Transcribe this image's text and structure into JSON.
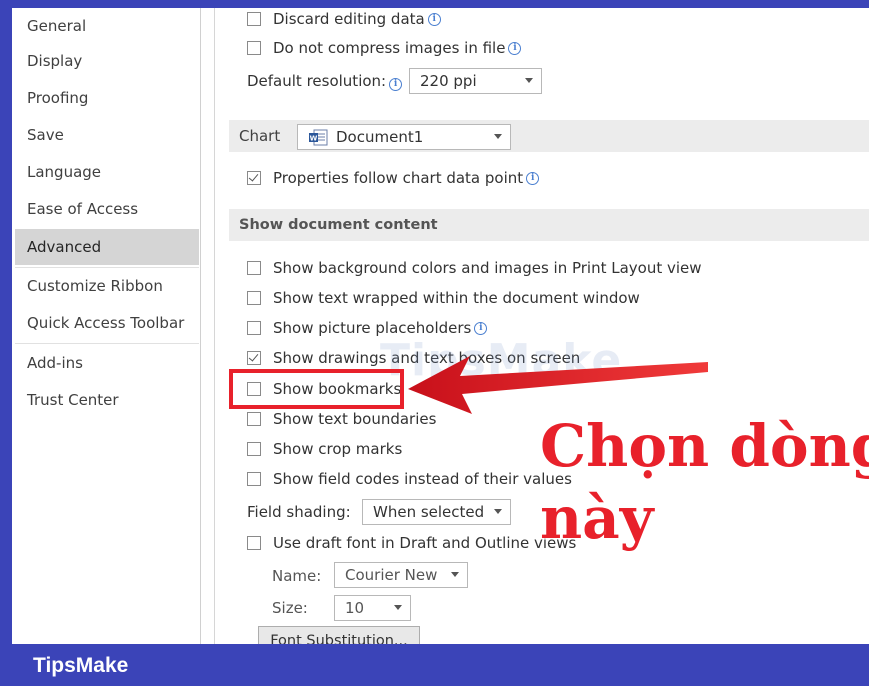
{
  "sidebar": {
    "items": [
      {
        "label": "General"
      },
      {
        "label": "Display"
      },
      {
        "label": "Proofing"
      },
      {
        "label": "Save"
      },
      {
        "label": "Language"
      },
      {
        "label": "Ease of Access"
      },
      {
        "label": "Advanced"
      },
      {
        "label": "Customize Ribbon"
      },
      {
        "label": "Quick Access Toolbar"
      },
      {
        "label": "Add-ins"
      },
      {
        "label": "Trust Center"
      }
    ],
    "active": "Advanced"
  },
  "image_size": {
    "discard_editing_data": "Discard editing data",
    "do_not_compress": "Do not compress images in file",
    "default_resolution_label": "Default resolution:",
    "default_resolution_value": "220 ppi"
  },
  "chart": {
    "section_label": "Chart",
    "document_value": "Document1",
    "properties_follow": "Properties follow chart data point"
  },
  "show_document_content": {
    "section_label": "Show document content",
    "options": [
      {
        "label": "Show background colors and images in Print Layout view",
        "checked": false
      },
      {
        "label": "Show text wrapped within the document window",
        "checked": false
      },
      {
        "label": "Show picture placeholders",
        "checked": false
      },
      {
        "label": "Show drawings and text boxes on screen",
        "checked": true
      },
      {
        "label": "Show bookmarks",
        "checked": false
      },
      {
        "label": "Show text boundaries",
        "checked": false
      },
      {
        "label": "Show crop marks",
        "checked": false
      },
      {
        "label": "Show field codes instead of their values",
        "checked": false
      }
    ],
    "field_shading_label": "Field shading:",
    "field_shading_value": "When selected",
    "draft_font": "Use draft font in Draft and Outline views",
    "name_label": "Name:",
    "name_value": "Courier New",
    "size_label": "Size:",
    "size_value": "10",
    "font_substitution": "Font Substitution..."
  },
  "annotation": {
    "line1": "Chọn dòng",
    "line2": "này"
  },
  "watermark": {
    "text": "TipsMake",
    "suffix": ".com"
  },
  "brand": "TipsMake",
  "colors": {
    "frame_blue": "#3b44b8",
    "highlight_red": "#e8212b",
    "active_nav": "#d5d5d5"
  }
}
